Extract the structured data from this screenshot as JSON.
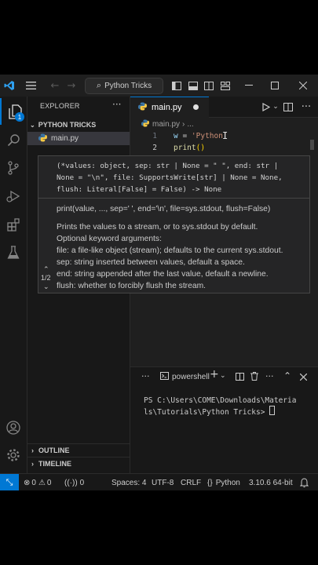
{
  "window": {
    "search_label": "Python Tricks"
  },
  "activity": {
    "explorer_badge": "1"
  },
  "sidebar": {
    "title": "EXPLORER",
    "folder": "PYTHON TRICKS",
    "file": "main.py",
    "outline": "OUTLINE",
    "timeline": "TIMELINE"
  },
  "editor": {
    "tab_label": "main.py",
    "breadcrumb_file": "main.py",
    "breadcrumb_more": "...",
    "lines": [
      {
        "num": "1",
        "var": "w",
        "op": " = ",
        "str": "'Python'"
      },
      {
        "num": "2",
        "fn": "print",
        "paren": "()"
      }
    ]
  },
  "hover": {
    "signature_lines": [
      "(*values: object, sep: str | None = \" \", end: str |",
      "None = \"\\n\", file: SupportsWrite[str] | None = None,",
      "flush: Literal[False] = False) -> None"
    ],
    "doc_lines": [
      "print(value, ..., sep=' ', end='\\n', file=sys.stdout, flush=False)",
      "",
      "Prints the values to a stream, or to sys.stdout by default.",
      "Optional keyword arguments:",
      "file: a file-like object (stream); defaults to the current sys.stdout.",
      "sep: string inserted between values, default a space.",
      "end: string appended after the last value, default a newline.",
      "flush: whether to forcibly flush the stream."
    ],
    "page": "1/2"
  },
  "panel": {
    "terminal_name": "powershell",
    "terminal_lines": [
      "PS C:\\Users\\COME\\Downloads\\Materia",
      "ls\\Tutorials\\Python Tricks>"
    ]
  },
  "status": {
    "errors": "0",
    "warnings": "0",
    "ports": "0",
    "spaces": "Spaces: 4",
    "encoding": "UTF-8",
    "eol": "CRLF",
    "language": "Python",
    "interpreter": "3.10.6 64-bit"
  },
  "colors": {
    "accent": "#0078d4",
    "background": "#1f1f1f",
    "sidebar": "#181818"
  }
}
